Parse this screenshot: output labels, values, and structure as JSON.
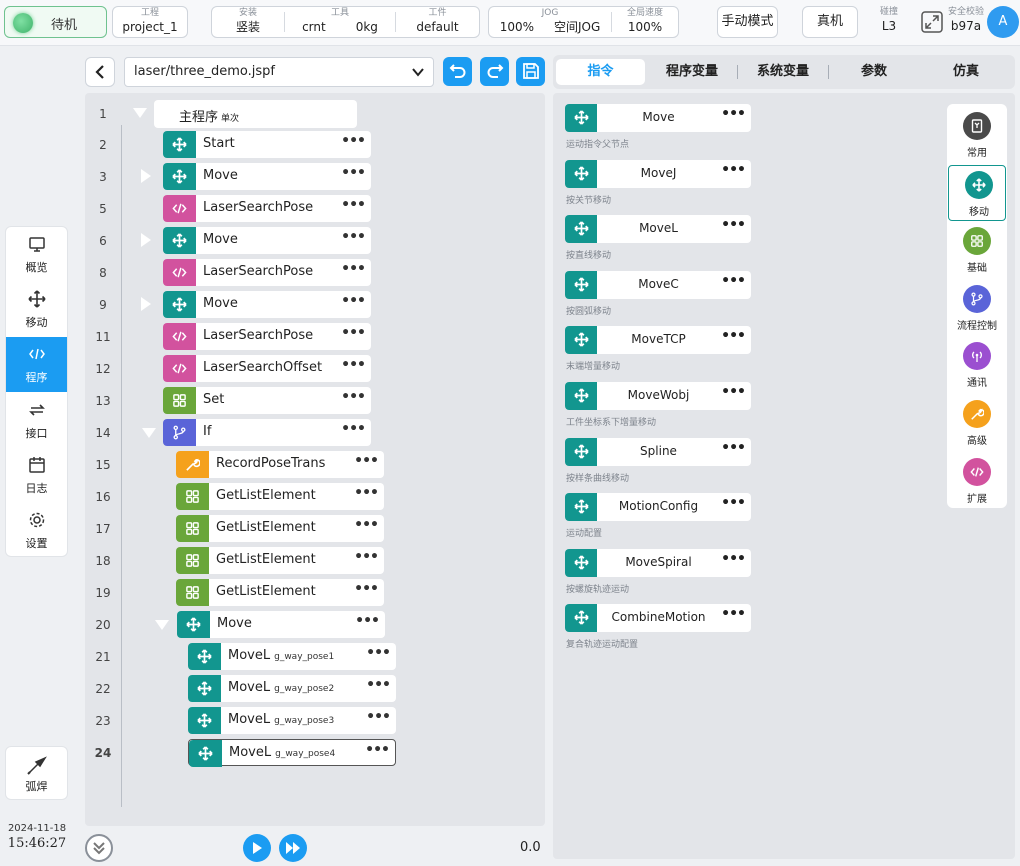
{
  "topbar": {
    "status": "待机",
    "project": {
      "label": "工程",
      "value": "project_1"
    },
    "install": {
      "label": "安装",
      "value": "竖装"
    },
    "tool": {
      "label": "工具",
      "value": "crnt",
      "payload": "0kg"
    },
    "workpiece": {
      "label": "工件",
      "value": "default"
    },
    "jog": {
      "label": "JOG",
      "speed": "100%",
      "mode": "空间JOG"
    },
    "global_speed": {
      "label": "全局速度",
      "value": "100%"
    },
    "manual_mode": "手动模式",
    "real_robot": "真机",
    "collision": {
      "label": "碰撞",
      "value": "L3"
    },
    "safety": {
      "label": "安全校验",
      "value": "b97a"
    },
    "avatar": "A"
  },
  "leftnav": {
    "items": [
      {
        "label": "概览",
        "icon": "monitor-icon"
      },
      {
        "label": "移动",
        "icon": "move-icon"
      },
      {
        "label": "程序",
        "icon": "code-icon"
      },
      {
        "label": "接口",
        "icon": "interface-icon"
      },
      {
        "label": "日志",
        "icon": "calendar-icon"
      },
      {
        "label": "设置",
        "icon": "gear-icon"
      }
    ],
    "active": "程序",
    "weld": "弧焊",
    "date": "2024-11-18",
    "time": "15:46:27"
  },
  "file": {
    "name": "laser/three_demo.jspf"
  },
  "tree": {
    "root": {
      "label": "主程序",
      "sub": "单次"
    },
    "nodes": [
      {
        "line": "2",
        "label": "Start",
        "sub": "",
        "type": "move"
      },
      {
        "line": "3",
        "label": "Move",
        "sub": "",
        "type": "move"
      },
      {
        "line": "5",
        "label": "LaserSearchPose",
        "sub": "",
        "type": "ext"
      },
      {
        "line": "6",
        "label": "Move",
        "sub": "",
        "type": "move"
      },
      {
        "line": "8",
        "label": "LaserSearchPose",
        "sub": "",
        "type": "ext"
      },
      {
        "line": "9",
        "label": "Move",
        "sub": "",
        "type": "move"
      },
      {
        "line": "11",
        "label": "LaserSearchPose",
        "sub": "",
        "type": "ext"
      },
      {
        "line": "12",
        "label": "LaserSearchOffset",
        "sub": "",
        "type": "ext"
      },
      {
        "line": "13",
        "label": "Set",
        "sub": "",
        "type": "basic"
      },
      {
        "line": "14",
        "label": "If",
        "sub": "",
        "type": "flow"
      },
      {
        "line": "15",
        "label": "RecordPoseTrans",
        "sub": "",
        "type": "adv"
      },
      {
        "line": "16",
        "label": "GetListElement",
        "sub": "",
        "type": "basic"
      },
      {
        "line": "17",
        "label": "GetListElement",
        "sub": "",
        "type": "basic"
      },
      {
        "line": "18",
        "label": "GetListElement",
        "sub": "",
        "type": "basic"
      },
      {
        "line": "19",
        "label": "GetListElement",
        "sub": "",
        "type": "basic"
      },
      {
        "line": "20",
        "label": "Move",
        "sub": "",
        "type": "move"
      },
      {
        "line": "21",
        "label": "MoveL",
        "sub": "g_way_pose1",
        "type": "move"
      },
      {
        "line": "22",
        "label": "MoveL",
        "sub": "g_way_pose2",
        "type": "move"
      },
      {
        "line": "23",
        "label": "MoveL",
        "sub": "g_way_pose3",
        "type": "move"
      },
      {
        "line": "24",
        "label": "MoveL",
        "sub": "g_way_pose4",
        "type": "move"
      }
    ],
    "speed_value": "0.0"
  },
  "tabs": [
    "指令",
    "程序变量",
    "系统变量",
    "参数",
    "仿真"
  ],
  "active_tab": "指令",
  "commands": [
    {
      "label": "Move",
      "desc": "运动指令父节点"
    },
    {
      "label": "MoveJ",
      "desc": "按关节移动"
    },
    {
      "label": "MoveL",
      "desc": "按直线移动"
    },
    {
      "label": "MoveC",
      "desc": "按圆弧移动"
    },
    {
      "label": "MoveTCP",
      "desc": "末端增量移动"
    },
    {
      "label": "MoveWobj",
      "desc": "工件坐标系下增量移动"
    },
    {
      "label": "Spline",
      "desc": "按样条曲线移动"
    },
    {
      "label": "MotionConfig",
      "desc": "运动配置"
    },
    {
      "label": "MoveSpiral",
      "desc": "按螺旋轨迹运动"
    },
    {
      "label": "CombineMotion",
      "desc": "复合轨迹运动配置"
    }
  ],
  "categories": [
    {
      "label": "常用",
      "icon": "bookmark-icon",
      "color": "#4a4a4a"
    },
    {
      "label": "移动",
      "icon": "move-icon",
      "color": "#12968f"
    },
    {
      "label": "基础",
      "icon": "grid-icon",
      "color": "#6aa63a"
    },
    {
      "label": "流程控制",
      "icon": "branch-icon",
      "color": "#5a64d8"
    },
    {
      "label": "通讯",
      "icon": "antenna-icon",
      "color": "#9b4fd0"
    },
    {
      "label": "高级",
      "icon": "wrench-icon",
      "color": "#f5a11c"
    },
    {
      "label": "扩展",
      "icon": "code-icon",
      "color": "#d2529e"
    }
  ],
  "colors": {
    "accent": "#1b9cf2",
    "move": "#12968f",
    "ext": "#d2529e",
    "basic": "#6aa63a",
    "flow": "#5a64d8",
    "adv": "#f5a11c"
  }
}
